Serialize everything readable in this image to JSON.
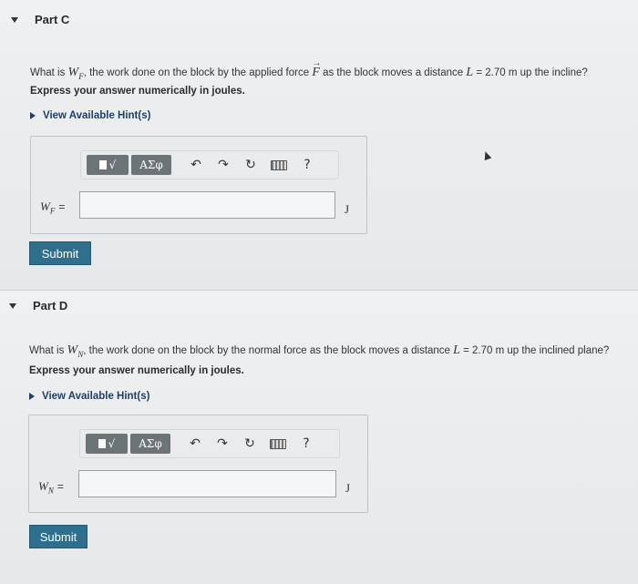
{
  "partC": {
    "heading": "Part C",
    "question_prefix": "What is ",
    "question_var": "W",
    "question_sub": "F",
    "question_mid": ", the work done on the block by the applied force ",
    "question_force": "F",
    "question_end": " as the block moves a distance ",
    "question_L": "L",
    "question_value": " = 2.70 m up the incline?",
    "instruction": "Express your answer numerically in joules.",
    "hint_label": "View Available Hint(s)",
    "var_name": "W",
    "var_sub": "F",
    "equals": "=",
    "unit": "J",
    "submit_label": "Submit"
  },
  "partD": {
    "heading": "Part D",
    "question_prefix": "What is ",
    "question_var": "W",
    "question_sub": "N",
    "question_mid": ", the work done on the block by the normal force as the block moves a distance ",
    "question_L": "L",
    "question_value": " = 2.70 m up the inclined plane?",
    "instruction": "Express your answer numerically in joules.",
    "hint_label": "View Available Hint(s)",
    "var_name": "W",
    "var_sub": "N",
    "equals": "=",
    "unit": "J",
    "submit_label": "Submit"
  },
  "toolbar": {
    "template_symbol": "√",
    "greek_label": "ΑΣφ",
    "undo_symbol": "↶",
    "redo_symbol": "↷",
    "reset_symbol": "↻",
    "help_symbol": "?"
  },
  "icons": [
    "caret-down-icon",
    "play-triangle-icon",
    "template-icon",
    "greek-icon",
    "undo-icon",
    "redo-icon",
    "reset-icon",
    "keyboard-icon",
    "help-icon"
  ]
}
